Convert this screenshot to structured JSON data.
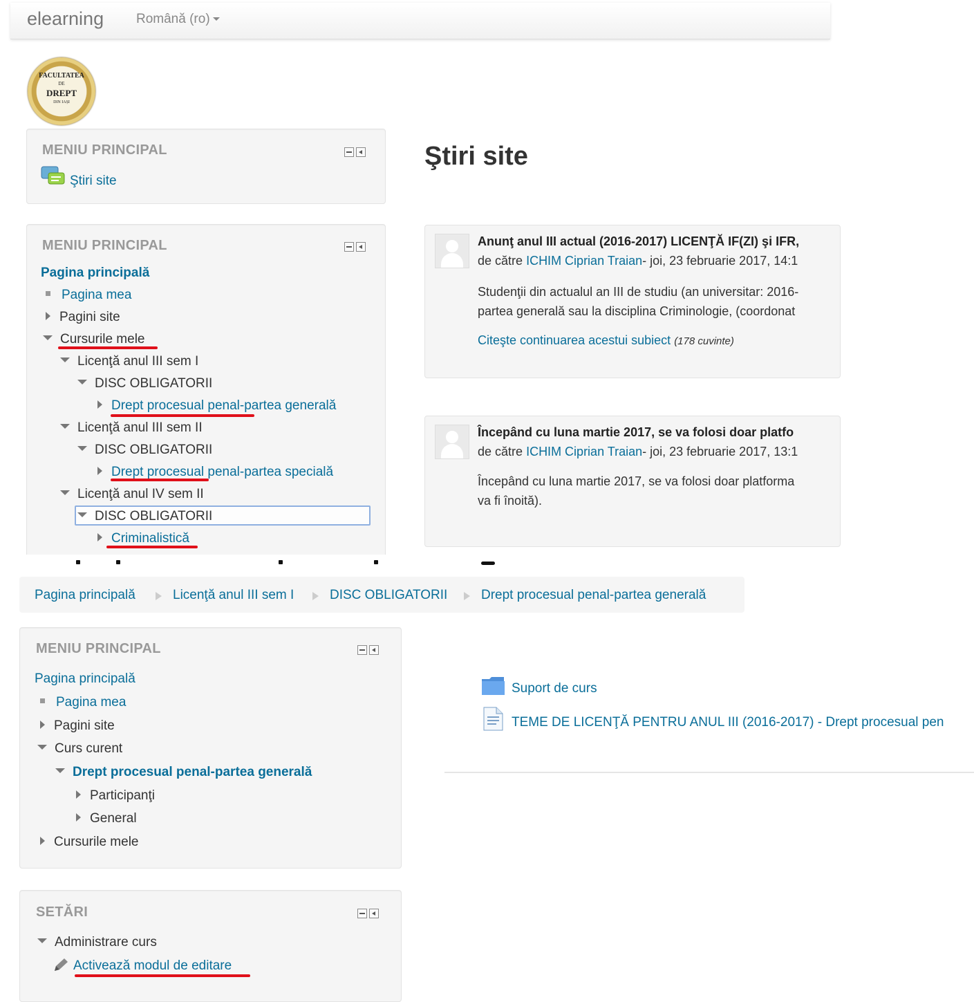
{
  "navbar": {
    "brand": "elearning",
    "language": "Română (ro)"
  },
  "logo": {
    "line1": "FACULTATEA",
    "line2": "DE",
    "line3": "DREPT",
    "line4": "DIN IAȘI"
  },
  "block1": {
    "title": "MENIU PRINCIPAL",
    "link": "Ştiri site"
  },
  "block2": {
    "title": "MENIU PRINCIPAL",
    "items": [
      "Pagina principală",
      "Pagina mea",
      "Pagini site",
      "Cursurile mele",
      "Licenţă anul III sem I",
      "DISC OBLIGATORII",
      "Drept procesual penal-partea generală",
      "Licenţă anul III sem II",
      "DISC OBLIGATORII",
      "Drept procesual penal-partea specială",
      "Licenţă anul IV sem II",
      "DISC OBLIGATORII",
      "Criminalistică"
    ]
  },
  "news": {
    "heading": "Ştiri site",
    "posts": [
      {
        "title": "Anunţ anul III actual (2016-2017) LICENŢĂ IF(ZI) şi IFR,",
        "by": "de către",
        "author": "ICHIM Ciprian Traian",
        "date": "- joi, 23 februarie 2017, 14:1",
        "body1": "Studenţii din actualul an III de studiu (an universitar: 2016-",
        "body2": "partea generală sau la disciplina Criminologie, (coordonat",
        "more": "Citeşte continuarea acestui subiect",
        "words": "(178 cuvinte)"
      },
      {
        "title": "Începând cu luna martie 2017, se va folosi doar platfo",
        "by": "de către",
        "author": "ICHIM Ciprian Traian",
        "date": "- joi, 23 februarie 2017, 13:1",
        "body1": "Începând cu luna martie 2017, se va folosi doar platforma",
        "body2": "va fi înoită)."
      }
    ]
  },
  "breadcrumb": [
    "Pagina principală",
    "Licenţă anul III sem I",
    "DISC OBLIGATORII",
    "Drept procesual penal-partea generală"
  ],
  "block3": {
    "title": "MENIU PRINCIPAL",
    "items": [
      "Pagina principală",
      "Pagina mea",
      "Pagini site",
      "Curs curent",
      "Drept procesual penal-partea generală",
      "Participanţi",
      "General",
      "Cursurile mele"
    ]
  },
  "settings": {
    "title": "SETĂRI",
    "admin": "Administrare curs",
    "edit": "Activează modul de editare"
  },
  "resources": [
    {
      "label": "Suport de curs",
      "icon": "folder-icon"
    },
    {
      "label": "TEME DE LICENŢĂ PENTRU ANUL III (2016-2017) - Drept procesual pen",
      "icon": "file-icon"
    }
  ]
}
